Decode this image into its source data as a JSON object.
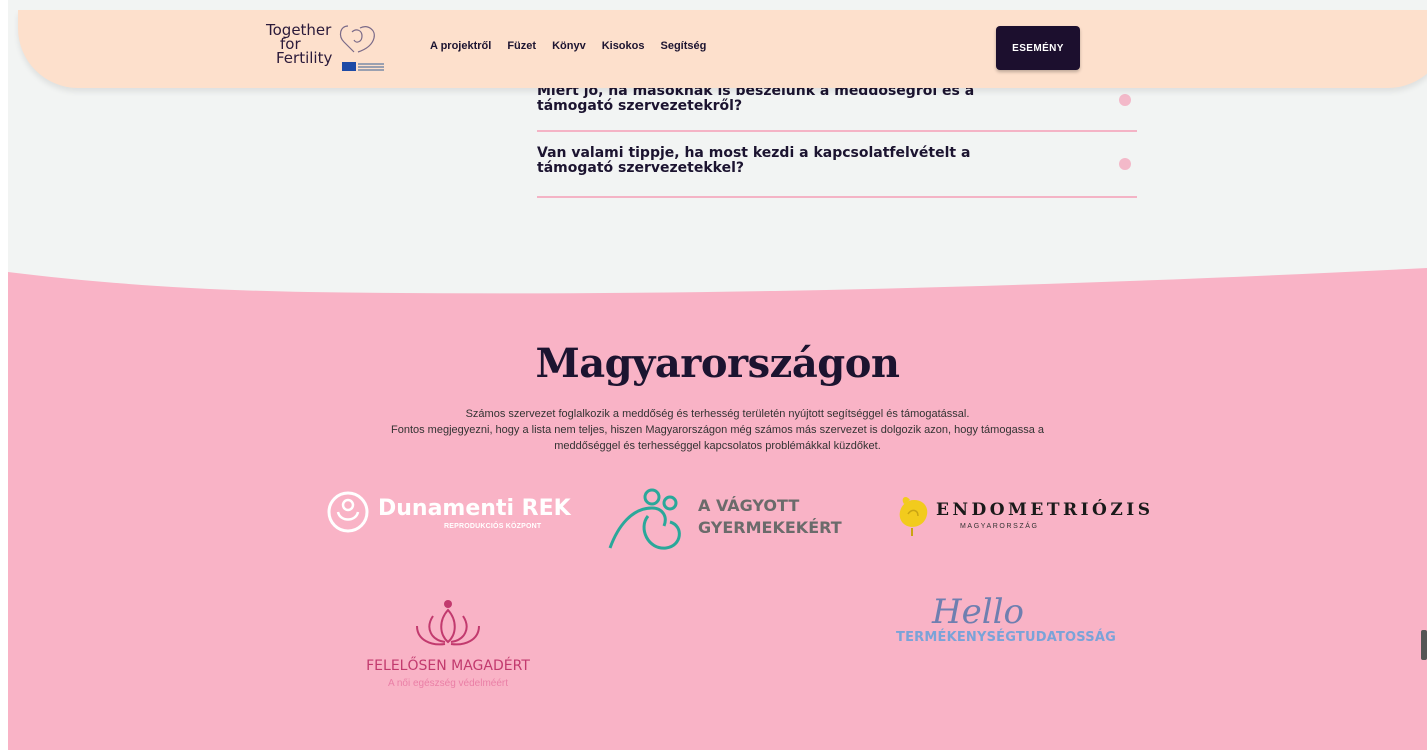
{
  "header": {
    "logo": {
      "line1": "Together",
      "line2": "for",
      "line3": "Fertility"
    },
    "nav": [
      "A projektről",
      "Füzet",
      "Könyv",
      "Kisokos",
      "Segítség"
    ],
    "event_button": "ESEMÉNY"
  },
  "faq": [
    {
      "question": "Miért jó, ha másoknak is beszélünk a meddőségről és a támogató szervezetekről?"
    },
    {
      "question": "Van valami tippje, ha most kezdi a kapcsolatfelvételt a támogató szervezetekkel?"
    }
  ],
  "section": {
    "title": "Magyarországon",
    "description_lines": [
      "Számos szervezet foglalkozik a meddőség és terhesség területén nyújtott segítséggel és támogatással.",
      "Fontos megjegyezni, hogy a lista nem teljes, hiszen Magyarországon még számos más szervezet is dolgozik azon, hogy támogassa a",
      "meddőséggel és terhességgel kapcsolatos problémákkal küzdőket."
    ]
  },
  "orgs": {
    "dunamenti": {
      "name": "Dunamenti REK",
      "subtitle": "REPRODUKCIÓS KÖZPONT"
    },
    "vagyott": {
      "line1": "A VÁGYOTT",
      "line2": "GYERMEKEKÉRT"
    },
    "endo": {
      "name": "ENDOMETRIÓZIS",
      "subtitle": "MAGYARORSZÁG"
    },
    "felelosen": {
      "name": "FELELŐSEN MAGADÉRT",
      "subtitle": "A női egészség védelméért"
    },
    "hello": {
      "script": "Hello",
      "subtitle": "TERMÉKENYSÉGTUDATOSSÁG"
    }
  },
  "colors": {
    "header_bg": "#fde0cc",
    "pink_bg": "#f9b3c6",
    "dark": "#1c0f2e",
    "teal": "#2aa89a"
  }
}
